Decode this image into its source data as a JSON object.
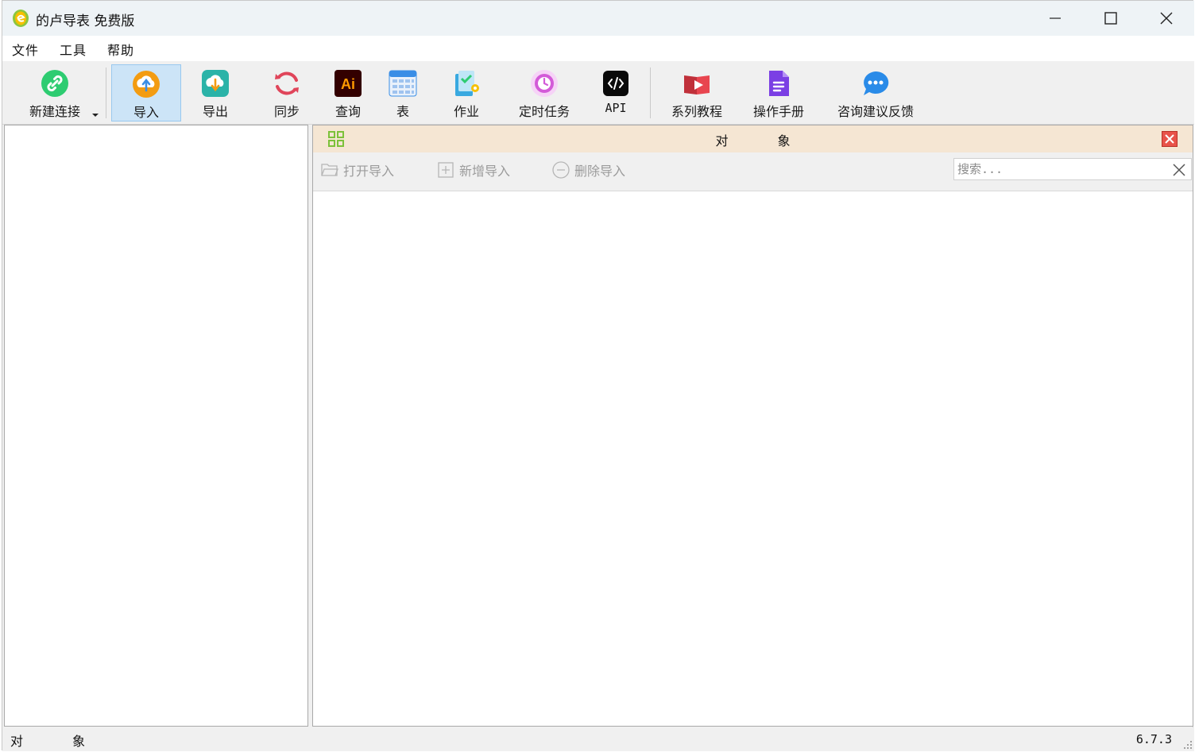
{
  "window": {
    "title": "的卢导表 免费版"
  },
  "menu": {
    "items": [
      "文件",
      "工具",
      "帮助"
    ]
  },
  "toolbar": {
    "tools": [
      {
        "label": "新建连接",
        "icon": "link-icon",
        "color": "#2ecc71"
      },
      {
        "label": "导入",
        "icon": "cloud-upload-icon",
        "color": "#f39c12",
        "active": true
      },
      {
        "label": "导出",
        "icon": "cloud-download-icon",
        "color": "#2bb3a8"
      },
      {
        "label": "同步",
        "icon": "sync-icon",
        "color": "#e0455a"
      },
      {
        "label": "查询",
        "icon": "query-ai-icon",
        "color": "#ff7a00"
      },
      {
        "label": "表",
        "icon": "table-icon",
        "color": "#3a8ee6"
      },
      {
        "label": "作业",
        "icon": "job-icon",
        "color": "#39a9e0"
      },
      {
        "label": "定时任务",
        "icon": "schedule-icon",
        "color": "#d35bd8"
      },
      {
        "label": "API",
        "icon": "api-icon",
        "color": "#111111"
      },
      {
        "label": "系列教程",
        "icon": "tutorial-video-icon",
        "color": "#e8454f"
      },
      {
        "label": "操作手册",
        "icon": "manual-icon",
        "color": "#7b3fe4"
      },
      {
        "label": "咨询建议反馈",
        "icon": "chat-feedback-icon",
        "color": "#2a8be8"
      }
    ]
  },
  "object_panel": {
    "title": "对象",
    "actions": {
      "open_import": "打开导入",
      "new_import": "新增导入",
      "delete_import": "删除导入"
    },
    "search": {
      "placeholder": "搜索...",
      "value": ""
    }
  },
  "status": {
    "left": "对象",
    "version": "6.7.3"
  }
}
